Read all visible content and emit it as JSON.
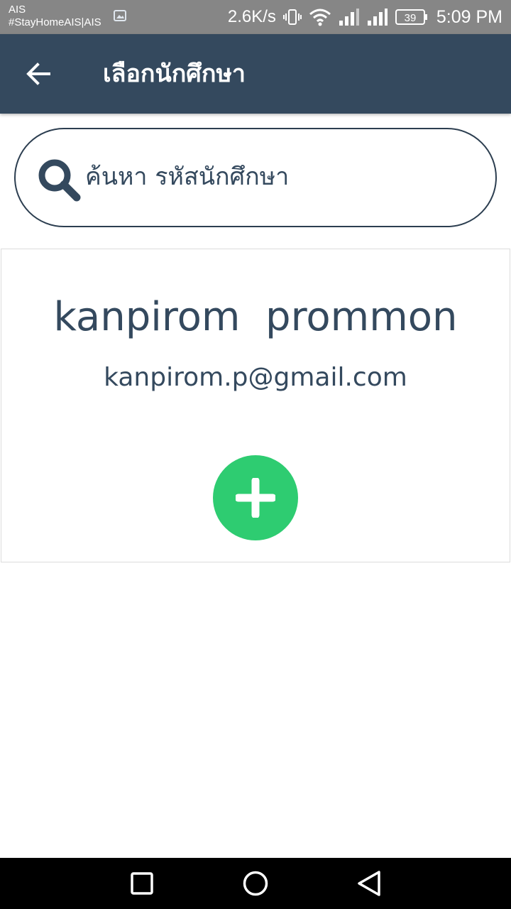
{
  "status_bar": {
    "carrier_line1": "AIS",
    "carrier_line2": "#StayHomeAIS|AIS",
    "net_speed": "2.6K/s",
    "battery": "39",
    "time": "5:09 PM",
    "icons": [
      "gallery-icon",
      "vibrate-icon",
      "wifi-icon",
      "signal-icon",
      "signal-icon",
      "battery-icon"
    ]
  },
  "app_bar": {
    "title": "เลือกนักศึกษา",
    "back_icon": "arrow-left-icon",
    "background": "#34495e"
  },
  "search": {
    "placeholder": "ค้นหา รหัสนักศึกษา",
    "value": "",
    "icon": "search-icon"
  },
  "student": {
    "name": "kanpirom  prommon",
    "email": "kanpirom.p@gmail.com",
    "add_icon": "plus-icon",
    "add_color": "#2ecc71",
    "text_color": "#34495e"
  },
  "nav_bar": {
    "icons": [
      "square-recents-icon",
      "circle-home-icon",
      "triangle-back-icon"
    ]
  }
}
